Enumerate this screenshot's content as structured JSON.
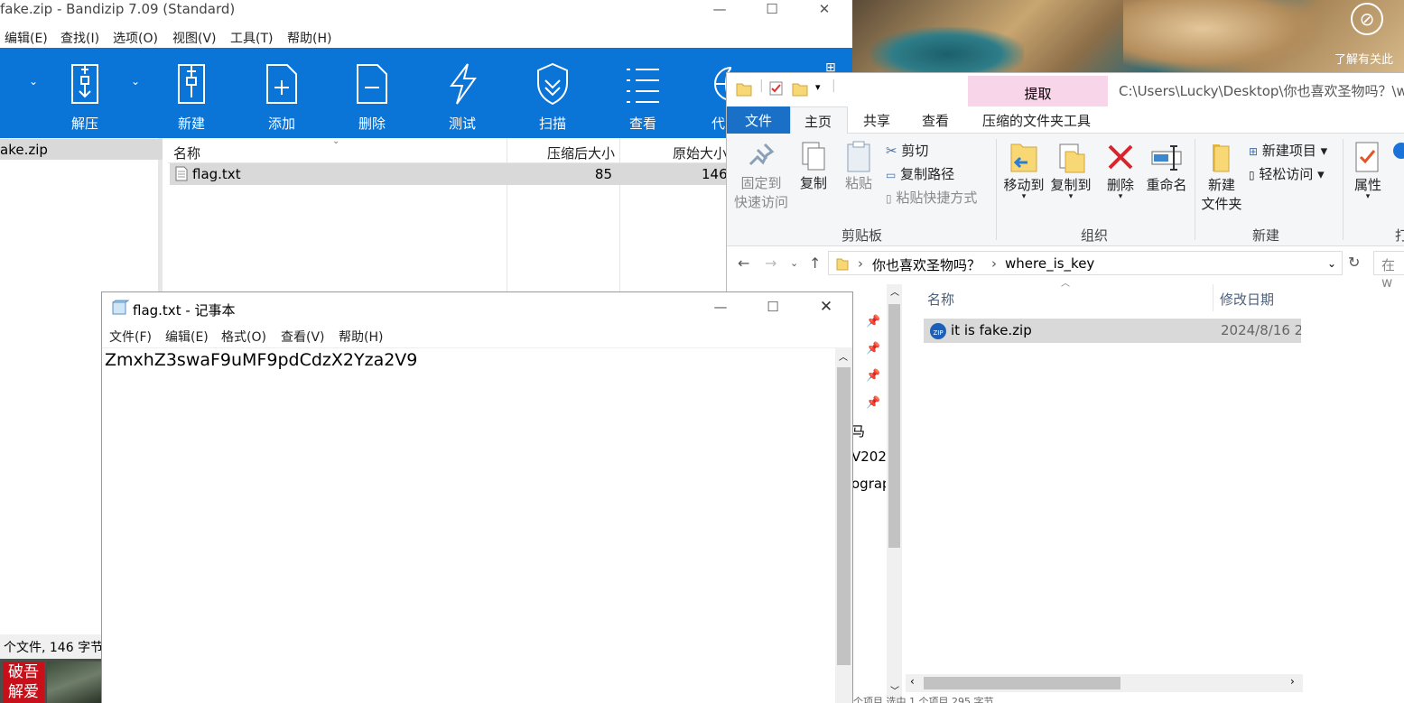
{
  "desktop": {
    "notice_text": "了解有关此"
  },
  "bandizip": {
    "title": "fake.zip - Bandizip 7.09 (Standard)",
    "menu": [
      "编辑(E)",
      "查找(I)",
      "选项(O)",
      "视图(V)",
      "工具(T)",
      "帮助(H)"
    ],
    "toolbar": [
      "解压",
      "新建",
      "添加",
      "删除",
      "测试",
      "扫描",
      "查看",
      "代"
    ],
    "left_item": "ake.zip",
    "columns": {
      "name": "名称",
      "compressed": "压缩后大小",
      "original": "原始大小"
    },
    "file": {
      "name": "flag.txt",
      "compressed": "85",
      "original": "146"
    },
    "status": "个文件, 146 字节",
    "seal": "破吾解爱"
  },
  "explorer": {
    "context_tab": "提取",
    "path_title": "C:\\Users\\Lucky\\Desktop\\你也喜欢圣物吗？\\w",
    "tabs": {
      "file": "文件",
      "home": "主页",
      "share": "共享",
      "view": "查看",
      "tools": "压缩的文件夹工具"
    },
    "clipboard": {
      "pin1": "固定到",
      "pin2": "快速访问",
      "copy": "复制",
      "paste": "粘贴",
      "cut": "剪切",
      "copypath": "复制路径",
      "pasteshortcut": "粘贴快捷方式",
      "group": "剪贴板"
    },
    "organize": {
      "moveto": "移动到",
      "copyto": "复制到",
      "delete": "删除",
      "rename": "重命名",
      "group": "组织"
    },
    "newgrp": {
      "newfolder1": "新建",
      "newfolder2": "文件夹",
      "newitem": "新建项目 ▾",
      "easyaccess": "轻松访问 ▾",
      "group": "新建"
    },
    "open": {
      "properties": "属性",
      "group": "打"
    },
    "address": {
      "crumb1": "你也喜欢圣物吗？",
      "crumb2": "where_is_key",
      "search": "在 w"
    },
    "nav_partial": [
      "马",
      "V202",
      "ograp"
    ],
    "columns": {
      "name": "名称",
      "modified": "修改日期"
    },
    "file": {
      "name": "it is fake.zip",
      "date": "2024/8/16 2"
    },
    "bottom_text": "个项目 选中 1 个项目 295 字节"
  },
  "notepad": {
    "title": "flag.txt - 记事本",
    "menu": [
      "文件(F)",
      "编辑(E)",
      "格式(O)",
      "查看(V)",
      "帮助(H)"
    ],
    "content": "ZmxhZ3swaF9uMF9pdCdzX2Yza2V9"
  }
}
